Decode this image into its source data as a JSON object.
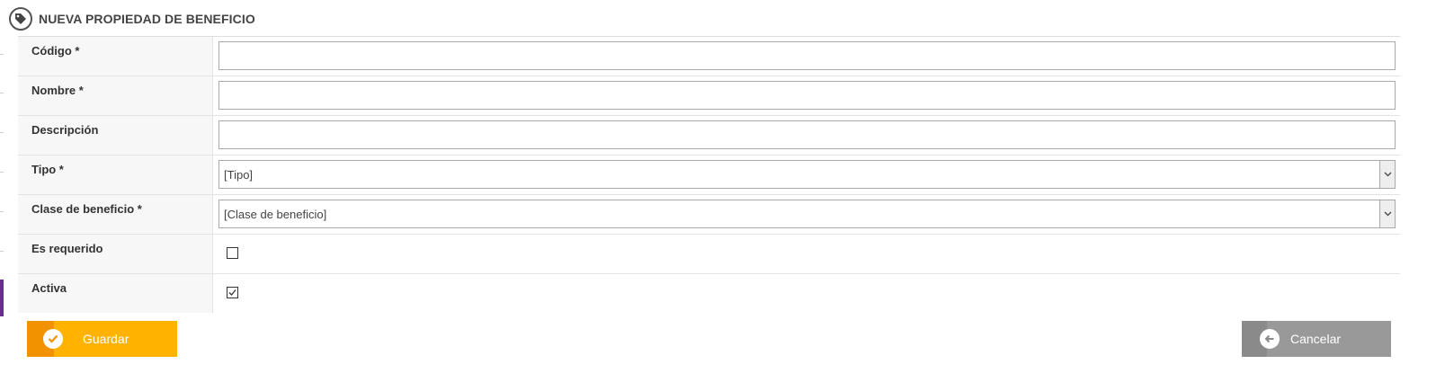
{
  "header": {
    "title": "NUEVA PROPIEDAD DE BENEFICIO",
    "icon": "tag-icon"
  },
  "form": {
    "codigo": {
      "label": "Código *",
      "value": ""
    },
    "nombre": {
      "label": "Nombre *",
      "value": ""
    },
    "descripcion": {
      "label": "Descripción",
      "value": ""
    },
    "tipo": {
      "label": "Tipo *",
      "selected": "[Tipo]"
    },
    "clase": {
      "label": "Clase de beneficio *",
      "selected": "[Clase de beneficio]"
    },
    "requerido": {
      "label": "Es requerido",
      "checked": false
    },
    "activa": {
      "label": "Activa",
      "checked": true
    }
  },
  "buttons": {
    "save": {
      "label": "Guardar",
      "icon": "check-icon"
    },
    "cancel": {
      "label": "Cancelar",
      "icon": "arrow-left-icon"
    }
  },
  "colors": {
    "save_main": "#ffb300",
    "save_icon_area": "#f39200",
    "cancel_main": "#999999",
    "cancel_icon_area": "#8a8a8a",
    "accent": "#6a2c91"
  }
}
